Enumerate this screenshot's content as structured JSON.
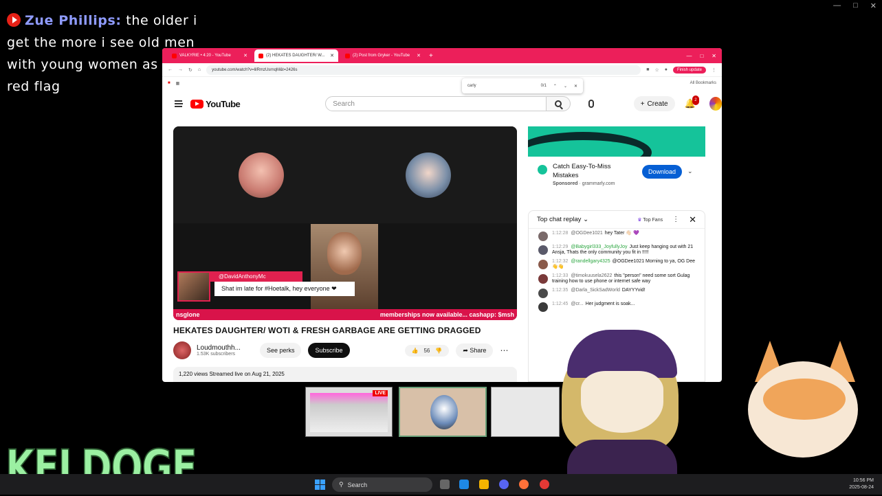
{
  "chat_overlay": {
    "name": "Zue Phillips:",
    "message_line1": "the older i",
    "message_line2": "get the more i see old men",
    "message_line3": "with young women as a",
    "message_line4": "red flag"
  },
  "browser": {
    "tabs": [
      {
        "label": "VALKYRIE • 4:20 - YouTube"
      },
      {
        "label": "(2) HEKATES DAUGHTER/ W..."
      },
      {
        "label": "(2) Post from Gryker - YouTube"
      }
    ],
    "url": "youtube.com/watch?v=lilRmzUsrnqM&t=2426s",
    "finish_update": "Finish update",
    "all_bookmarks": "All Bookmarks",
    "find": {
      "query": "carly",
      "count": "0/1"
    }
  },
  "youtube": {
    "logo": "YouTube",
    "search_placeholder": "Search",
    "create_label": "Create",
    "notification_count": "2",
    "video": {
      "lower_third_handle": "@DavidAnthonyMc",
      "lower_third_message": "Shat im late for #Hoetalk, hey everyone ❤",
      "ticker_left": "nsglone",
      "ticker_right": "memberships now available... cashapp: $msh"
    },
    "title": "HEKATES DAUGHTER/ WOTI & FRESH GARBAGE ARE GETTING DRAGGED",
    "channel_name": "Loudmouthh...",
    "channel_subs": "1.53K subscribers",
    "perks_label": "See perks",
    "subscribe_label": "Subscribe",
    "like_count": "56",
    "share_label": "Share",
    "description": "1,220 views  Streamed live on Aug 21, 2025",
    "ad": {
      "title": "Catch Easy-To-Miss Mistakes",
      "sponsored": "Sponsored",
      "domain": "grammarly.com",
      "download_label": "Download"
    },
    "chat": {
      "header": "Top chat replay",
      "top_fans": "Top Fans",
      "messages": [
        {
          "time": "1:12:28",
          "author": "@OGDee1021",
          "text": "hey Tater 👋🏻 💜",
          "color": "#666666"
        },
        {
          "time": "1:12:29",
          "author": "@Babygirl333_JoyfullyJoy",
          "text": "Just keep hanging out with 21 Ansja, Thats the only community you fit in !!!!!",
          "color": "#2ba640"
        },
        {
          "time": "1:12:32",
          "author": "@randellgary4325",
          "text": "@OGDee1021 Morning to ya, OG Dee 👋👋",
          "color": "#2ba640"
        },
        {
          "time": "1:12:33",
          "author": "@timokuusela2622",
          "text": "this \"person\" need some sort Gulag training how to use phone or internet safe way",
          "color": "#666666"
        },
        {
          "time": "1:12:35",
          "author": "@Darla_SickSadWorld",
          "text": "DAYYYvid!",
          "color": "#666666"
        },
        {
          "time": "1:12:45",
          "author": "@cr...",
          "text": "Her judgment is soak...",
          "color": "#666666"
        }
      ]
    }
  },
  "taskbar": {
    "live_badge": "LIVE",
    "search_label": "Search",
    "time": "10:56 PM",
    "date": "2025-08-24"
  },
  "overlay_logo": "KELDOGE",
  "colors": {
    "browser_accent": "#ec1f5a",
    "yt_red": "#ff0000",
    "ad_green": "#15c39a",
    "download_blue": "#065fd4",
    "chat_name": "#8f9bff",
    "logo_green": "#9bf0a2"
  }
}
